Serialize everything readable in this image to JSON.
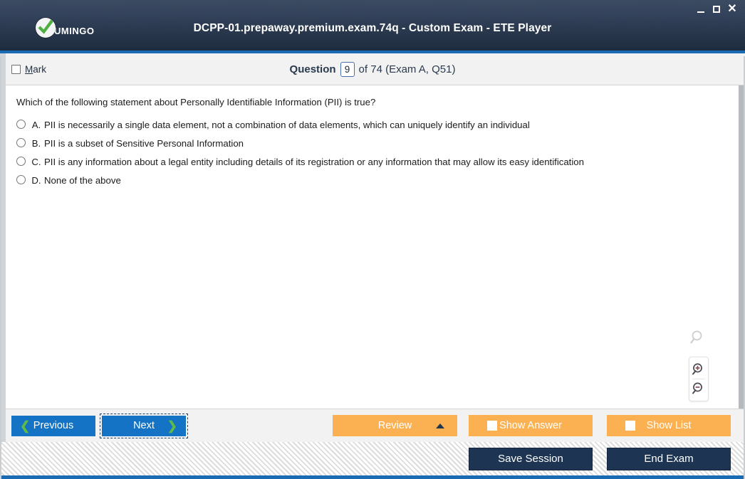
{
  "window": {
    "title": "DCPP-01.prepaway.premium.exam.74q - Custom Exam - ETE Player",
    "logo_text": "UMINGO",
    "minimize_label": "—",
    "maximize_label": "□",
    "close_label": "✕",
    "accent_blue": "#1a6ab4",
    "titlebar_dark": "#2a3951"
  },
  "question_header": {
    "mark_label_prefix": "M",
    "mark_label_rest": "ark",
    "question_label": "Question",
    "current_number": "9",
    "rest": "of 74 (Exam A, Q51)"
  },
  "question": {
    "text": "Which of the following statement about Personally Identifiable Information (PII) is true?",
    "choices": [
      {
        "letter": "A.",
        "text": "PII is necessarily a single data element, not a combination of data elements, which can uniquely identify an individual",
        "selected": false
      },
      {
        "letter": "B.",
        "text": "PII is a subset of Sensitive Personal Information",
        "selected": false
      },
      {
        "letter": "C.",
        "text": "PII is any information about a legal entity including details of its registration or any information that may allow its easy identification",
        "selected": false
      },
      {
        "letter": "D.",
        "text": "None of the above",
        "selected": false
      }
    ]
  },
  "magnifier": {
    "solo_icon": "magnifier-icon",
    "zoom_in_icon": "zoom-in-icon",
    "zoom_out_icon": "zoom-out-icon"
  },
  "navbar": {
    "previous_label": "Previous",
    "previous_chevron": "❮",
    "next_label": "Next",
    "next_chevron": "❯",
    "review_label": "Review",
    "show_answer_label": "Show Answer",
    "show_list_label": "Show List",
    "chevron_color": "#5fba46",
    "blue_button_color": "#1473c4",
    "orange_button_color": "#fbb152"
  },
  "footer": {
    "save_session_label": "Save Session",
    "end_exam_label": "End Exam",
    "dark_button_color": "#1d3553"
  }
}
